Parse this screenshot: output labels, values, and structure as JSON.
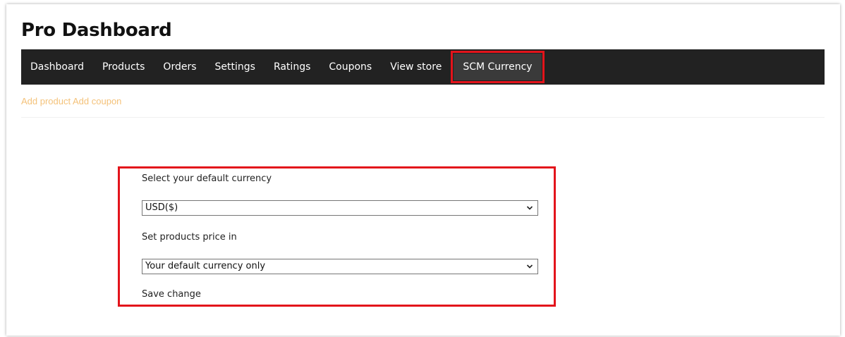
{
  "page": {
    "title": "Pro Dashboard"
  },
  "nav": {
    "items": [
      {
        "label": "Dashboard"
      },
      {
        "label": "Products"
      },
      {
        "label": "Orders"
      },
      {
        "label": "Settings"
      },
      {
        "label": "Ratings"
      },
      {
        "label": "Coupons"
      },
      {
        "label": "View store"
      },
      {
        "label": "SCM Currency",
        "active": true
      }
    ]
  },
  "quick_links": {
    "add_product": "Add product",
    "add_coupon": "Add coupon"
  },
  "currency_form": {
    "default_currency_label": "Select your default currency",
    "default_currency_value": "USD($)",
    "price_in_label": "Set products price in",
    "price_in_value": "Your default currency only",
    "save_label": "Save change"
  },
  "icons": {
    "select_chevron": "chevron-down-icon"
  },
  "colors": {
    "navbar_bg": "#222222",
    "highlight": "#e3141b",
    "link": "#f4c27a"
  }
}
